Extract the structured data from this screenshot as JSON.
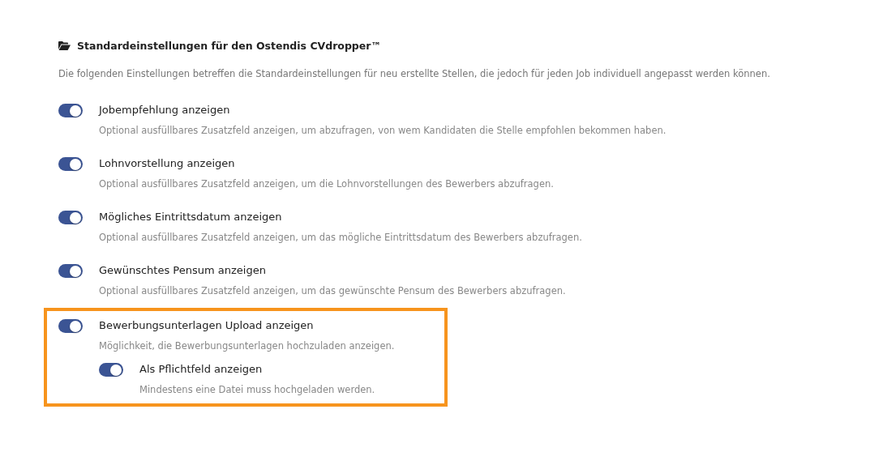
{
  "section": {
    "title": "Standardeinstellungen für den Ostendis CVdropper™",
    "description": "Die folgenden Einstellungen betreffen die Standardeinstellungen für neu erstellte Stellen, die jedoch für jeden Job individuell angepasst werden können."
  },
  "settings": [
    {
      "label": "Jobempfehlung anzeigen",
      "hint": "Optional ausfüllbares Zusatzfeld anzeigen, um abzufragen, von wem Kandidaten die Stelle empfohlen bekommen haben.",
      "on": true,
      "highlighted": false
    },
    {
      "label": "Lohnvorstellung anzeigen",
      "hint": "Optional ausfüllbares Zusatzfeld anzeigen, um die Lohnvorstellungen des Bewerbers abzufragen.",
      "on": true,
      "highlighted": false
    },
    {
      "label": "Mögliches Eintrittsdatum anzeigen",
      "hint": "Optional ausfüllbares Zusatzfeld anzeigen, um das mögliche Eintrittsdatum des Bewerbers abzufragen.",
      "on": true,
      "highlighted": false
    },
    {
      "label": "Gewünschtes Pensum anzeigen",
      "hint": "Optional ausfüllbares Zusatzfeld anzeigen, um das gewünschte Pensum des Bewerbers abzufragen.",
      "on": true,
      "highlighted": false
    },
    {
      "label": "Bewerbungsunterlagen Upload anzeigen",
      "hint": "Möglichkeit, die Bewerbungsunterlagen hochzuladen anzeigen.",
      "on": true,
      "highlighted": true,
      "children": [
        {
          "label": "Als Pflichtfeld anzeigen",
          "hint": "Mindestens eine Datei muss hochgeladen werden.",
          "on": true
        }
      ]
    }
  ]
}
